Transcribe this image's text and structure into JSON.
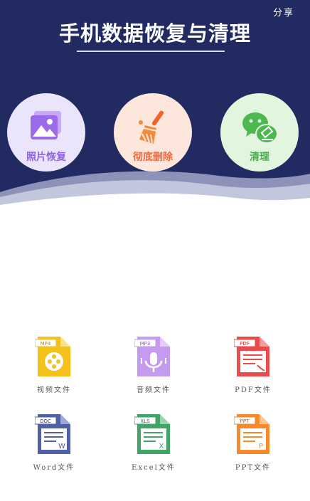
{
  "header": {
    "share_label": "分享",
    "title": "手机数据恢复与清理",
    "bg_color": "#222a62"
  },
  "features": [
    {
      "label": "照片恢复",
      "icon": "photo-gallery-icon",
      "color": "#8f63e6",
      "bg": "#ebe5fb"
    },
    {
      "label": "彻底删除",
      "icon": "broom-icon",
      "color": "#ee6a3e",
      "bg": "#fde7dd"
    },
    {
      "label": "清理",
      "icon": "wechat-clean-icon",
      "color": "#47b04a",
      "bg": "#e2f5df"
    }
  ],
  "files": [
    {
      "label": "视频文件",
      "tag": "MP4",
      "icon": "video-file-icon",
      "color": "#f5c21b"
    },
    {
      "label": "音频文件",
      "tag": "MP3",
      "icon": "audio-file-icon",
      "color": "#c59bf0"
    },
    {
      "label": "PDF文件",
      "tag": "PDF",
      "icon": "pdf-file-icon",
      "color": "#ea4a4a"
    },
    {
      "label": "Word文件",
      "tag": "DOC",
      "icon": "word-file-icon",
      "color": "#4f5fa8"
    },
    {
      "label": "Excel文件",
      "tag": "XLS",
      "icon": "excel-file-icon",
      "color": "#3fa565"
    },
    {
      "label": "PPT文件",
      "tag": "PPT",
      "icon": "ppt-file-icon",
      "color": "#f5892c"
    }
  ]
}
